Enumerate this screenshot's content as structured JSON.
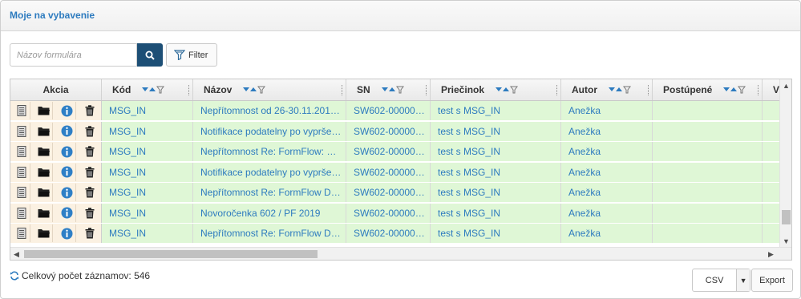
{
  "panel": {
    "title": "Moje na vybavenie"
  },
  "search": {
    "placeholder": "Názov formulára",
    "value": ""
  },
  "toolbar": {
    "filter_label": "Filter"
  },
  "grid": {
    "columns": [
      "Akcia",
      "Kód",
      "Názov",
      "SN",
      "Priečinok",
      "Autor",
      "Postúpené",
      "V"
    ],
    "rows": [
      {
        "kod": "MSG_IN",
        "nazov": "Nepřítomnost od 26-30.11.201…",
        "sn": "SW602-00000…",
        "priecinok": "test s MSG_IN",
        "autor": "Anežka",
        "postupene": ""
      },
      {
        "kod": "MSG_IN",
        "nazov": "Notifikace podatelny po vypršе…",
        "sn": "SW602-00000…",
        "priecinok": "test s MSG_IN",
        "autor": "Anežka",
        "postupene": ""
      },
      {
        "kod": "MSG_IN",
        "nazov": "Nepřítomnost Re: FormFlow: …",
        "sn": "SW602-00000…",
        "priecinok": "test s MSG_IN",
        "autor": "Anežka",
        "postupene": ""
      },
      {
        "kod": "MSG_IN",
        "nazov": "Notifikace podatelny po vypršе…",
        "sn": "SW602-00000…",
        "priecinok": "test s MSG_IN",
        "autor": "Anežka",
        "postupene": ""
      },
      {
        "kod": "MSG_IN",
        "nazov": "Nepřítomnost Re: FormFlow D…",
        "sn": "SW602-00000…",
        "priecinok": "test s MSG_IN",
        "autor": "Anežka",
        "postupene": ""
      },
      {
        "kod": "MSG_IN",
        "nazov": "Novoročenka 602 / PF 2019",
        "sn": "SW602-00000…",
        "priecinok": "test s MSG_IN",
        "autor": "Anežka",
        "postupene": ""
      },
      {
        "kod": "MSG_IN",
        "nazov": "Nepřítomnost Re: FormFlow D…",
        "sn": "SW602-00000…",
        "priecinok": "test s MSG_IN",
        "autor": "Anežka",
        "postupene": ""
      }
    ]
  },
  "footer": {
    "count_label": "Celkový počet záznamov: 546"
  },
  "export": {
    "format": "CSV",
    "button_label": "Export"
  },
  "colors": {
    "accent": "#2d7bbf",
    "search_button": "#1d4f76",
    "row_bg": "#dff7d6",
    "action_bg": "#fbf1e2"
  },
  "icons": [
    "search-icon",
    "filter-icon",
    "document-icon",
    "folder-icon",
    "info-icon",
    "trash-icon",
    "refresh-icon",
    "sort-icon",
    "chevron-down-icon"
  ]
}
